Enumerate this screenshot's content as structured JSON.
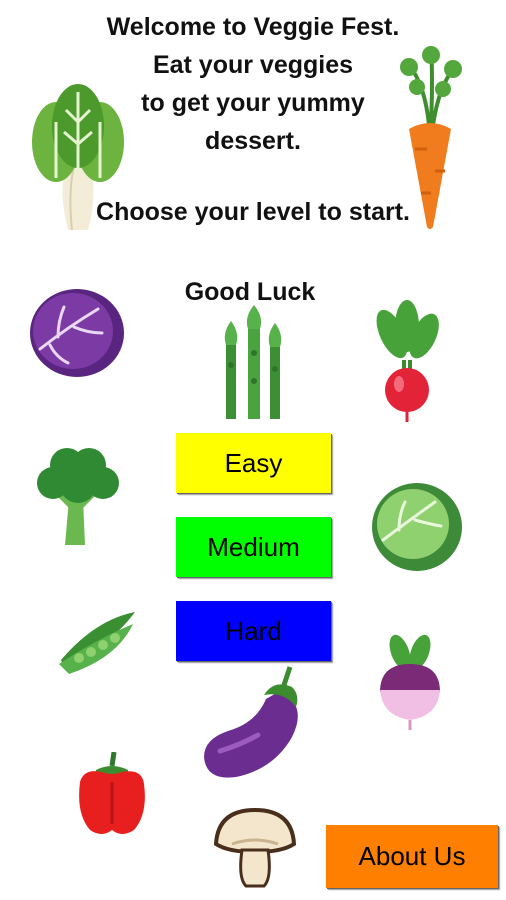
{
  "intro": {
    "lines": [
      "Welcome to Veggie Fest.",
      "Eat your veggies",
      "to get your yummy",
      "dessert."
    ],
    "start_line": "Choose your level to start.",
    "good_luck": "Good Luck"
  },
  "levels": [
    {
      "label": "Easy",
      "color": "#ffff00"
    },
    {
      "label": "Medium",
      "color": "#00ff00"
    },
    {
      "label": "Hard",
      "color": "#0000ff"
    }
  ],
  "about": {
    "label": "About Us",
    "color": "#ff8000"
  },
  "icons": [
    "bok-choy-icon",
    "carrot-icon",
    "red-cabbage-icon",
    "asparagus-icon",
    "radish-icon",
    "broccoli-icon",
    "green-cabbage-icon",
    "peas-icon",
    "turnip-icon",
    "eggplant-icon",
    "bell-pepper-icon",
    "mushroom-icon"
  ]
}
